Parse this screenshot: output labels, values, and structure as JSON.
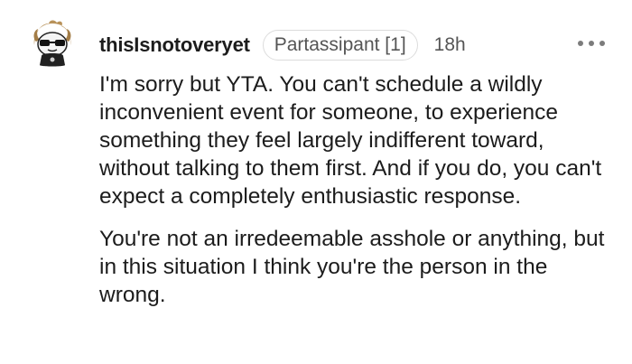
{
  "comment": {
    "username": "thisIsnotoveryet",
    "flair": "Partassipant [1]",
    "timestamp": "18h",
    "paragraphs": [
      "I'm sorry but YTA. You can't schedule a wildly inconvenient event for someone, to experience something they feel largely indifferent toward, without talking to them first. And if you do, you can't expect a completely enthusiastic response.",
      "You're not an irredeemable asshole or anything, but in this situation I think you're the person in the wrong."
    ]
  },
  "icons": {
    "avatar": "snoo-avatar-with-sunglasses-icon",
    "more": "more-options-icon"
  },
  "colors": {
    "text": "#1c1c1c",
    "muted": "#555555",
    "flair_border": "#dcdcdc",
    "avatar_hair": "#b8925a"
  }
}
